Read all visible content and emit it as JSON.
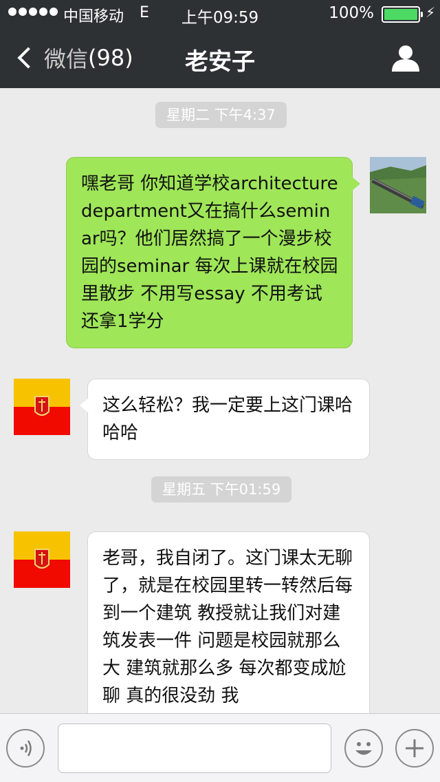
{
  "status_bar": {
    "carrier": "中国移动",
    "network": "E",
    "time": "上午09:59",
    "battery_percent": "100%",
    "battery_level": 1.0,
    "battery_color": "#4cd964"
  },
  "nav": {
    "back_label": "微信",
    "back_count": "(98)",
    "title": "老安子",
    "back_icon": "chevron-left-icon",
    "right_icon": "person-icon"
  },
  "messages": [
    {
      "type": "timestamp",
      "text": "星期二 下午4:37"
    },
    {
      "type": "message",
      "sender": "me",
      "text": "嘿老哥 你知道学校architecture department又在搞什么seminar吗？他们居然搞了一个漫步校园的seminar 每次上课就在校园里散步 不用写essay 不用考试 还拿1学分"
    },
    {
      "type": "message",
      "sender": "contact",
      "text": "这么轻松？我一定要上这门课哈哈哈"
    },
    {
      "type": "timestamp",
      "text": "星期五 下午01:59"
    },
    {
      "type": "message",
      "sender": "contact",
      "text": "老哥，我自闭了。这门课太无聊了，就是在校园里转一转然后每到一个建筑 教授就让我们对建筑发表一件 问题是校园就那么大 建筑就那么多 每次都变成尬聊 真的很没劲 我"
    }
  ],
  "input_bar": {
    "placeholder": "",
    "left_icon": "voice-icon",
    "emoji_icon": "emoji-icon",
    "plus_icon": "plus-icon"
  },
  "colors": {
    "nav_bg": "#2e3134",
    "chat_bg": "#ebebeb",
    "my_bubble": "#9fe658",
    "their_bubble": "#ffffff"
  }
}
